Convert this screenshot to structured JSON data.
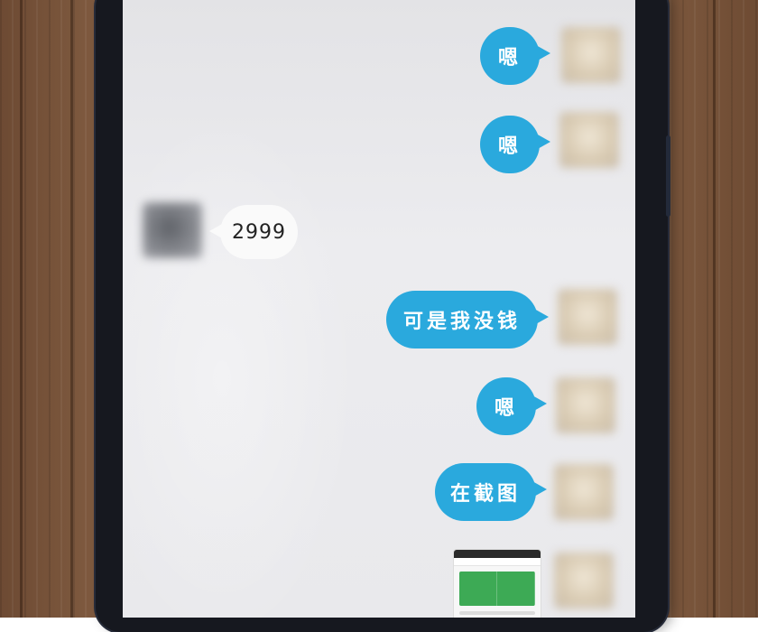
{
  "chat": {
    "messages": [
      {
        "side": "right",
        "text": "嗯"
      },
      {
        "side": "right",
        "text": "嗯"
      },
      {
        "side": "left",
        "text": "2999"
      },
      {
        "side": "right",
        "text": "可是我没钱"
      },
      {
        "side": "right",
        "text": "嗯"
      },
      {
        "side": "right",
        "text": "在截图"
      },
      {
        "side": "right",
        "type": "image-thumbnail"
      }
    ]
  },
  "colors": {
    "sent_bubble": "#2aa9dd",
    "received_bubble": "#fafafa",
    "screen_bg": "#e9e9ec",
    "phone_frame": "#16181f",
    "thumbnail_green": "#3daa55"
  }
}
